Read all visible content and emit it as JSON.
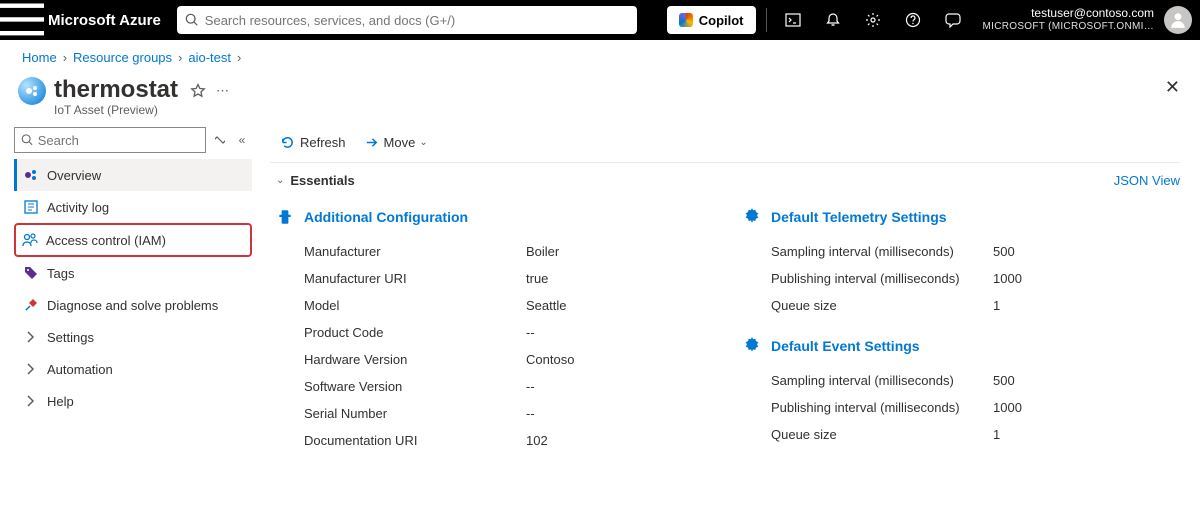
{
  "topbar": {
    "brand": "Microsoft Azure",
    "search_placeholder": "Search resources, services, and docs (G+/)",
    "copilot_label": "Copilot",
    "account_email": "testuser@contoso.com",
    "account_tenant": "MICROSOFT (MICROSOFT.ONMI…"
  },
  "breadcrumb": {
    "items": [
      "Home",
      "Resource groups",
      "aio-test"
    ]
  },
  "header": {
    "title": "thermostat",
    "subtitle": "IoT Asset (Preview)"
  },
  "sidebar": {
    "search_placeholder": "Search",
    "items": [
      {
        "label": "Overview"
      },
      {
        "label": "Activity log"
      },
      {
        "label": "Access control (IAM)"
      },
      {
        "label": "Tags"
      },
      {
        "label": "Diagnose and solve problems"
      },
      {
        "label": "Settings"
      },
      {
        "label": "Automation"
      },
      {
        "label": "Help"
      }
    ]
  },
  "commands": {
    "refresh": "Refresh",
    "move": "Move"
  },
  "essentials": {
    "label": "Essentials",
    "json_view": "JSON View"
  },
  "sections": {
    "addl_config": {
      "title": "Additional Configuration",
      "items": [
        {
          "k": "Manufacturer",
          "v": "Boiler"
        },
        {
          "k": "Manufacturer URI",
          "v": "true"
        },
        {
          "k": "Model",
          "v": "Seattle"
        },
        {
          "k": "Product Code",
          "v": "--"
        },
        {
          "k": "Hardware Version",
          "v": "Contoso"
        },
        {
          "k": "Software Version",
          "v": "--"
        },
        {
          "k": "Serial Number",
          "v": "--"
        },
        {
          "k": "Documentation URI",
          "v": "102"
        }
      ]
    },
    "telemetry": {
      "title": "Default Telemetry Settings",
      "items": [
        {
          "k": "Sampling interval (milliseconds)",
          "v": "500"
        },
        {
          "k": "Publishing interval (milliseconds)",
          "v": "1000"
        },
        {
          "k": "Queue size",
          "v": "1"
        }
      ]
    },
    "event": {
      "title": "Default Event Settings",
      "items": [
        {
          "k": "Sampling interval (milliseconds)",
          "v": "500"
        },
        {
          "k": "Publishing interval (milliseconds)",
          "v": "1000"
        },
        {
          "k": "Queue size",
          "v": "1"
        }
      ]
    }
  }
}
